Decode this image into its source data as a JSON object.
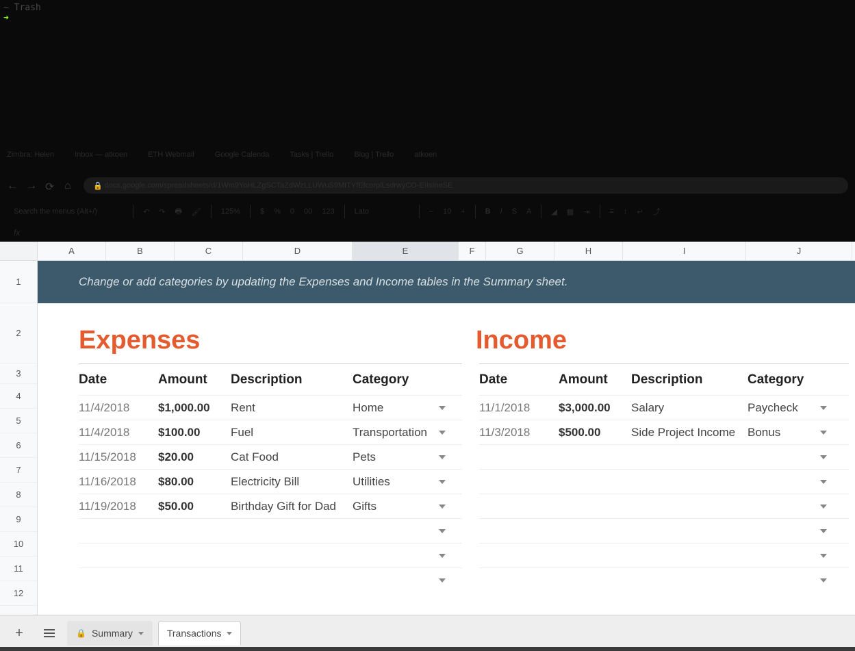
{
  "terminal": {
    "line1": "~ Trash",
    "arrow": "➜"
  },
  "browser": {
    "tabs": [
      "Zimbra: Helen",
      "Inbox — atkoen",
      "ETH Webmail",
      "Google Calenda",
      "Tasks | Trello",
      "Blog | Trello",
      "atkoen"
    ],
    "url_host": "docs.google.com",
    "url_path": "/spreadsheets/d/1Wm9YoHLZgSCTaZdWzLLUWuS9MtTYfEfcorplLsdrwyCO-EIIsIneSE"
  },
  "toolbar": {
    "search_placeholder": "Search the menus (Alt+/)",
    "zoom": "125%",
    "format_num": "123",
    "font": "Lato",
    "font_size": "10"
  },
  "fx": {
    "label": "fx"
  },
  "columns": [
    "A",
    "B",
    "C",
    "D",
    "E",
    "F",
    "G",
    "H",
    "I",
    "J"
  ],
  "rows": [
    "1",
    "2",
    "3",
    "4",
    "5",
    "6",
    "7",
    "8",
    "9",
    "10",
    "11",
    "12"
  ],
  "banner": "Change or add categories by updating the Expenses and Income tables in the Summary sheet.",
  "sections": {
    "expenses": "Expenses",
    "income": "Income"
  },
  "headers": {
    "date": "Date",
    "amount": "Amount",
    "desc": "Description",
    "cat": "Category"
  },
  "expenses": [
    {
      "date": "11/4/2018",
      "amount": "$1,000.00",
      "desc": "Rent",
      "cat": "Home"
    },
    {
      "date": "11/4/2018",
      "amount": "$100.00",
      "desc": "Fuel",
      "cat": "Transportation"
    },
    {
      "date": "11/15/2018",
      "amount": "$20.00",
      "desc": "Cat Food",
      "cat": "Pets"
    },
    {
      "date": "11/16/2018",
      "amount": "$80.00",
      "desc": "Electricity Bill",
      "cat": "Utilities"
    },
    {
      "date": "11/19/2018",
      "amount": "$50.00",
      "desc": "Birthday Gift for Dad",
      "cat": "Gifts"
    },
    {
      "date": "",
      "amount": "",
      "desc": "",
      "cat": ""
    },
    {
      "date": "",
      "amount": "",
      "desc": "",
      "cat": ""
    },
    {
      "date": "",
      "amount": "",
      "desc": "",
      "cat": ""
    }
  ],
  "income": [
    {
      "date": "11/1/2018",
      "amount": "$3,000.00",
      "desc": "Salary",
      "cat": "Paycheck"
    },
    {
      "date": "11/3/2018",
      "amount": "$500.00",
      "desc": "Side Project Income",
      "cat": "Bonus"
    },
    {
      "date": "",
      "amount": "",
      "desc": "",
      "cat": ""
    },
    {
      "date": "",
      "amount": "",
      "desc": "",
      "cat": ""
    },
    {
      "date": "",
      "amount": "",
      "desc": "",
      "cat": ""
    },
    {
      "date": "",
      "amount": "",
      "desc": "",
      "cat": ""
    },
    {
      "date": "",
      "amount": "",
      "desc": "",
      "cat": ""
    },
    {
      "date": "",
      "amount": "",
      "desc": "",
      "cat": ""
    }
  ],
  "sheet_tabs": {
    "summary": "Summary",
    "transactions": "Transactions"
  },
  "icons": {
    "dollar": "$",
    "percent": "%",
    "zero": "0",
    "decimals": "00"
  }
}
